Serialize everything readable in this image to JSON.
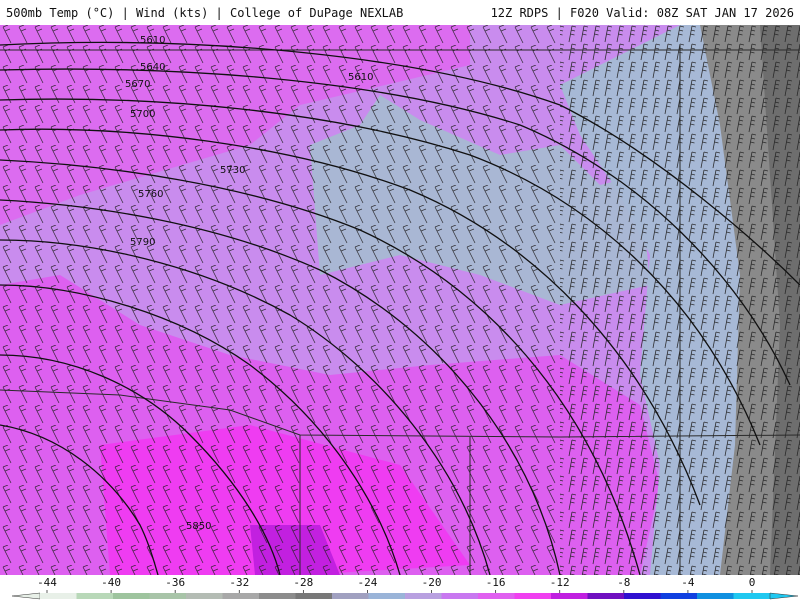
{
  "header": {
    "left_title": "500mb Temp (°C) | Wind (kts) | College of DuPage NEXLAB",
    "right_title": "12Z RDPS | F020 Valid: 08Z SAT JAN 17 2026"
  },
  "contour_labels": [
    "5610",
    "5640",
    "5670",
    "5610",
    "5700",
    "5730",
    "5760",
    "5790",
    "5850"
  ],
  "colorbar": {
    "tick_labels": [
      "-44",
      "-40",
      "-36",
      "-32",
      "-28",
      "-24",
      "-20",
      "-16",
      "-12",
      "-8",
      "-4",
      "0"
    ],
    "colors": [
      "#e8f0e8",
      "#b8d8b8",
      "#9ec49e",
      "#a8c4a8",
      "#b4bcb4",
      "#a8a8a8",
      "#8c8c8c",
      "#787878",
      "#a0a0c0",
      "#9ab4d8",
      "#b8a0e0",
      "#c878f0",
      "#e060f0",
      "#f040f0",
      "#c020e0",
      "#7010c0",
      "#3010d0",
      "#1040e0",
      "#1090e0",
      "#20c8f0"
    ]
  },
  "colors": {
    "magenta": "#e64ff0",
    "lavender": "#b880e8",
    "light_purple": "#c79ae8",
    "steel_blue": "#a7b9d6",
    "gray": "#8f8f8f",
    "dark_gray": "#707070"
  }
}
